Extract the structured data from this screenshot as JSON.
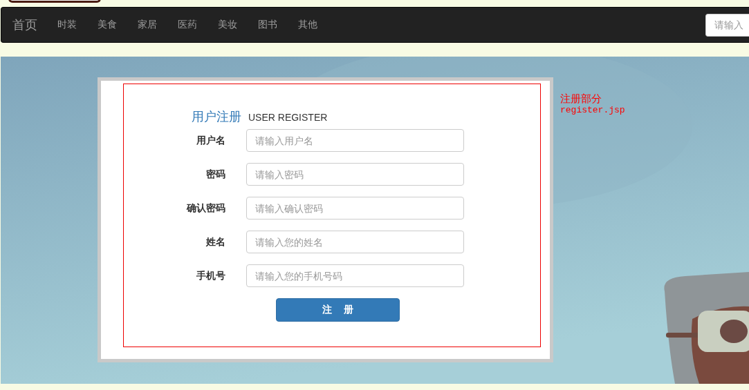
{
  "nav": {
    "brand": "首页",
    "items": [
      {
        "label": "时装"
      },
      {
        "label": "美食"
      },
      {
        "label": "家居"
      },
      {
        "label": "医药"
      },
      {
        "label": "美妆"
      },
      {
        "label": "图书"
      },
      {
        "label": "其他"
      }
    ],
    "search": {
      "placeholder": "请输入"
    }
  },
  "register": {
    "title": "用户注册",
    "subtitle": "USER REGISTER",
    "fields": [
      {
        "label": "用户名",
        "placeholder": "请输入用户名"
      },
      {
        "label": "密码",
        "placeholder": "请输入密码"
      },
      {
        "label": "确认密码",
        "placeholder": "请输入确认密码"
      },
      {
        "label": "姓名",
        "placeholder": "请输入您的姓名"
      },
      {
        "label": "手机号",
        "placeholder": "请输入您的手机号码"
      }
    ],
    "submit": "注 册"
  },
  "annotation": {
    "title": "注册部分",
    "file": "register.jsp"
  }
}
